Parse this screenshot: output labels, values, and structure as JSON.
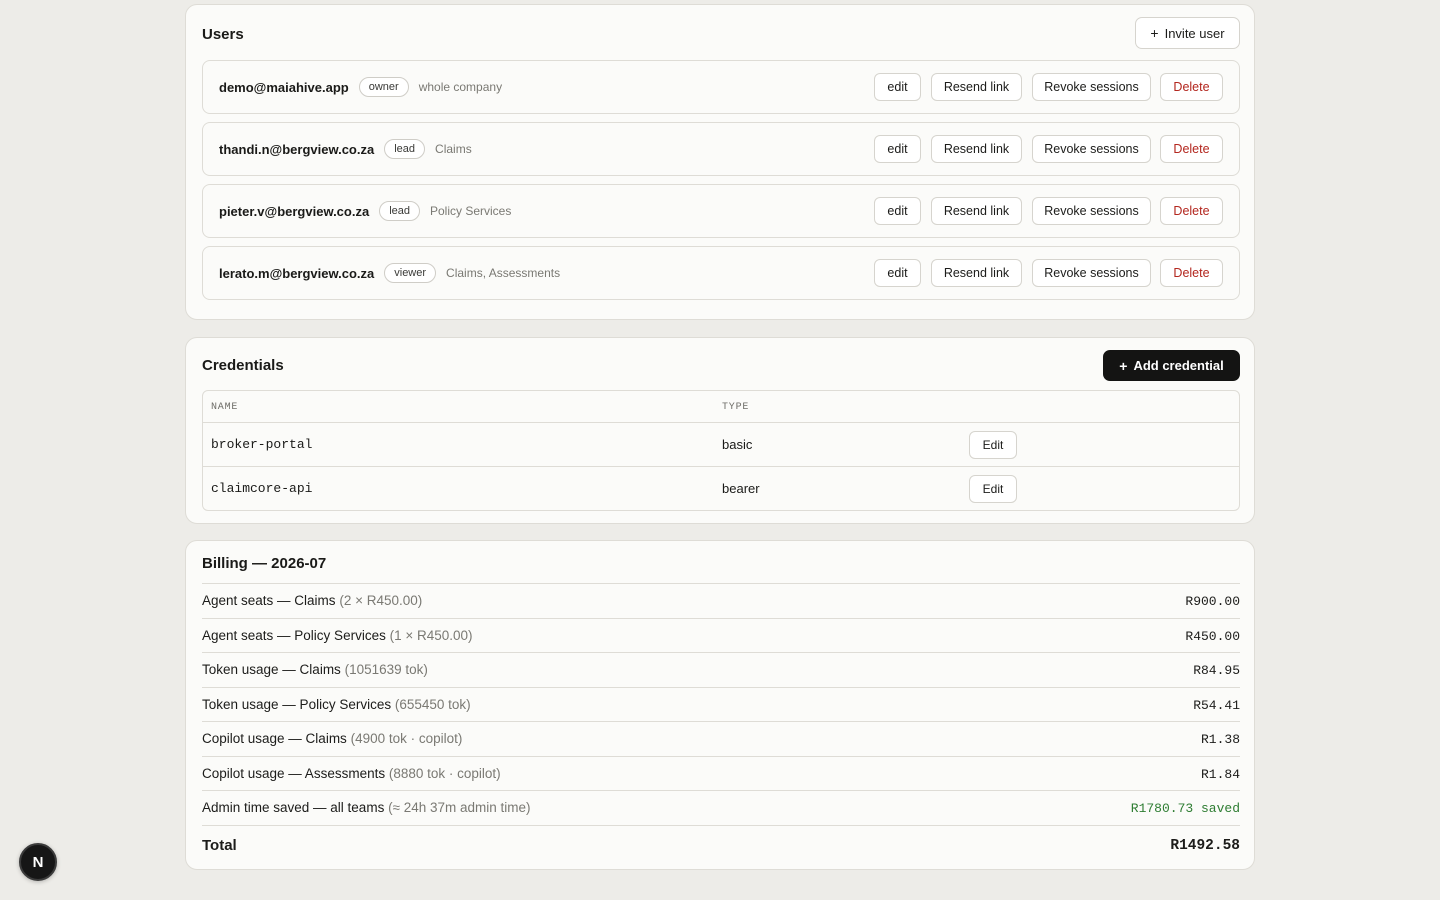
{
  "users": {
    "title": "Users",
    "invite_label": "Invite user",
    "actions": {
      "edit": "edit",
      "resend": "Resend link",
      "revoke": "Revoke sessions",
      "delete": "Delete"
    },
    "rows": [
      {
        "email": "demo@maiahive.app",
        "role": "owner",
        "scope": "whole company"
      },
      {
        "email": "thandi.n@bergview.co.za",
        "role": "lead",
        "scope": "Claims"
      },
      {
        "email": "pieter.v@bergview.co.za",
        "role": "lead",
        "scope": "Policy Services"
      },
      {
        "email": "lerato.m@bergview.co.za",
        "role": "viewer",
        "scope": "Claims, Assessments"
      }
    ]
  },
  "credentials": {
    "title": "Credentials",
    "add_label": "Add credential",
    "columns": [
      "NAME",
      "TYPE"
    ],
    "edit_label": "Edit",
    "rows": [
      {
        "name": "broker-portal",
        "type": "basic"
      },
      {
        "name": "claimcore-api",
        "type": "bearer"
      }
    ]
  },
  "billing": {
    "title": "Billing — 2026-07",
    "lines": [
      {
        "label": "Agent seats — Claims",
        "detail": "(2 × R450.00)",
        "amount": "R900.00"
      },
      {
        "label": "Agent seats — Policy Services",
        "detail": "(1 × R450.00)",
        "amount": "R450.00"
      },
      {
        "label": "Token usage — Claims",
        "detail": "(1051639 tok)",
        "amount": "R84.95"
      },
      {
        "label": "Token usage — Policy Services",
        "detail": "(655450 tok)",
        "amount": "R54.41"
      },
      {
        "label": "Copilot usage — Claims",
        "detail": "(4900 tok · copilot)",
        "amount": "R1.38"
      },
      {
        "label": "Copilot usage — Assessments",
        "detail": "(8880 tok · copilot)",
        "amount": "R1.84"
      },
      {
        "label": "Admin time saved — all teams",
        "detail": "(≈ 24h 37m admin time)",
        "amount": "R1780.73 saved"
      }
    ],
    "total_label": "Total",
    "total_amount": "R1492.58"
  },
  "fab": {
    "letter": "N"
  },
  "colors": {
    "background": "#edece8",
    "card": "#fbfbf9",
    "danger": "#b3261e",
    "saved": "#2e7d32",
    "primary_button": "#141413"
  }
}
